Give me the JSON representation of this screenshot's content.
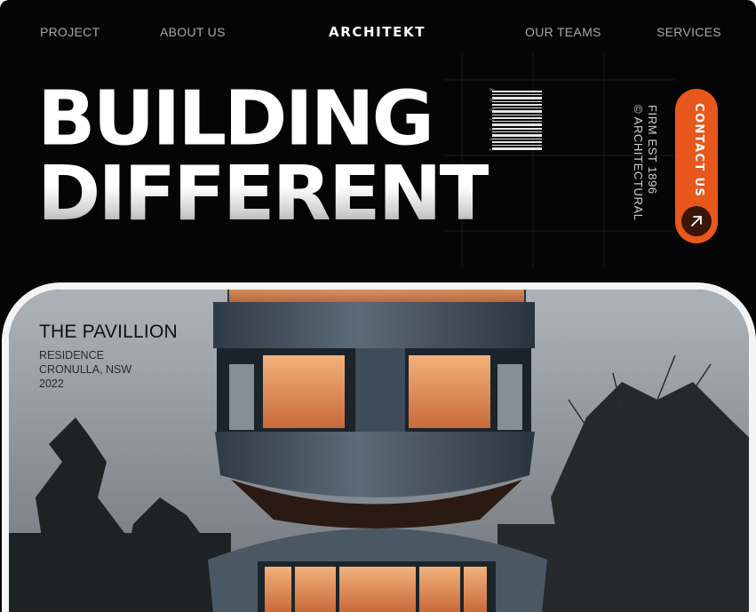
{
  "nav": {
    "items": [
      "PROJECT",
      "ABOUT US",
      "OUR TEAMS",
      "SERVICES"
    ],
    "brand": "ARCHITEKT"
  },
  "hero": {
    "line1": "BUILDING",
    "line2": "DIFFERENT",
    "barcode_digits": "8 9 3 7 2 6 1"
  },
  "side": {
    "line1": "© ARCHITECTURAL",
    "line2": "FIRM EST 1896"
  },
  "cta": {
    "label": "CONTACT US",
    "icon": "arrow-up-right-icon",
    "color": "#e8571c"
  },
  "project": {
    "title": "THE PAVILLION",
    "type": "RESIDENCE",
    "location": "CRONULLA, NSW",
    "year": "2022"
  }
}
